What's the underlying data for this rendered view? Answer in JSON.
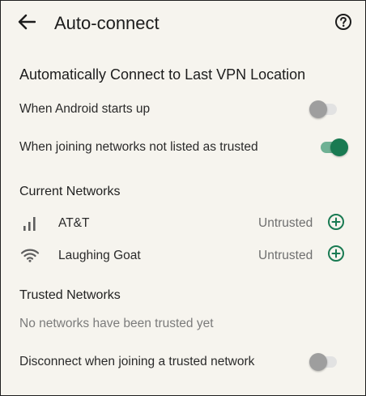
{
  "header": {
    "title": "Auto-connect",
    "back_icon": "arrow-back-icon",
    "help_icon": "help-circle-icon"
  },
  "auto_connect": {
    "heading": "Automatically Connect to Last VPN Location",
    "android_startup": {
      "label": "When Android starts up",
      "enabled": false
    },
    "untrusted_networks": {
      "label": "When joining networks not listed as trusted",
      "enabled": true
    }
  },
  "current_networks": {
    "heading": "Current Networks",
    "items": [
      {
        "name": "AT&T",
        "status": "Untrusted",
        "icon": "cellular-signal-icon"
      },
      {
        "name": "Laughing Goat",
        "status": "Untrusted",
        "icon": "wifi-icon"
      }
    ]
  },
  "trusted_networks": {
    "heading": "Trusted Networks",
    "empty_message": "No networks have been trusted yet",
    "disconnect": {
      "label": "Disconnect when joining a trusted network",
      "enabled": false
    }
  },
  "colors": {
    "background": "#f6f4ee",
    "accent": "#197a52",
    "toggle_on_track": "#6fb194",
    "toggle_off_thumb": "#9e9e9e",
    "toggle_off_track": "#e2e2e2"
  }
}
